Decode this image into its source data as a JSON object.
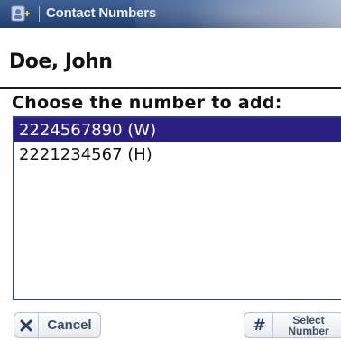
{
  "titlebar": {
    "icon": "contacts-app-icon",
    "title": "Contact Numbers"
  },
  "contact": {
    "name": "Doe, John"
  },
  "prompt": "Choose the number to add:",
  "numbers": [
    {
      "label": "2224567890 (W)",
      "selected": true
    },
    {
      "label": "2221234567 (H)",
      "selected": false
    }
  ],
  "buttons": {
    "cancel": {
      "icon": "x-icon",
      "label": "Cancel"
    },
    "select": {
      "icon": "hash-icon",
      "glyph": "#",
      "label_line1": "Select",
      "label_line2": "Number"
    }
  },
  "colors": {
    "titlebar": "#2f4f80",
    "selection": "#2a1f82",
    "list_border": "#33407a"
  }
}
